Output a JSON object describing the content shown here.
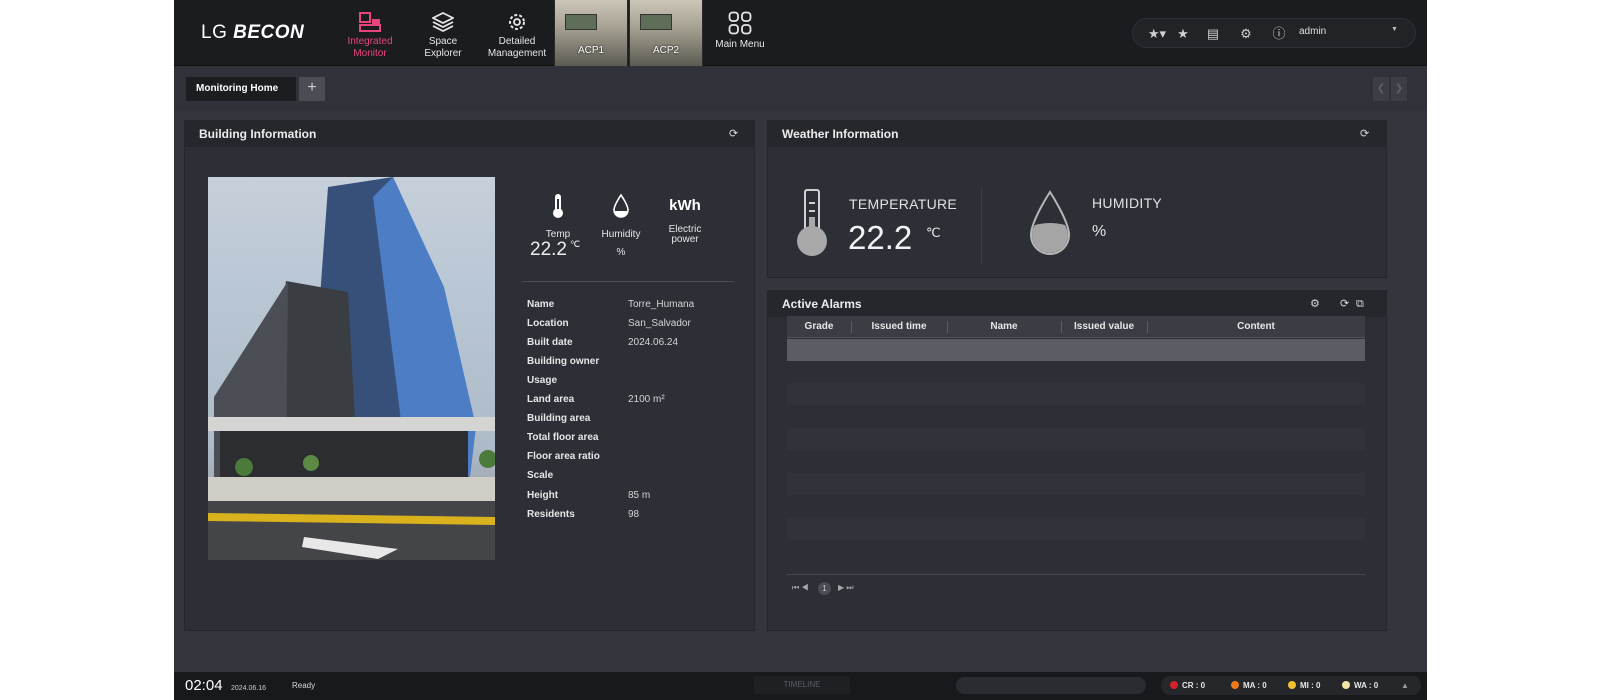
{
  "header": {
    "logo_lg": "LG",
    "logo_becon": "BECON",
    "nav": [
      {
        "label1": "Integrated",
        "label2": "Monitor"
      },
      {
        "label1": "Space",
        "label2": "Explorer"
      },
      {
        "label1": "Detailed",
        "label2": "Management"
      }
    ],
    "acp1": "ACP1",
    "acp2": "ACP2",
    "main_menu": "Main Menu",
    "user": "admin"
  },
  "tabs": {
    "active": "Monitoring Home",
    "add": "+"
  },
  "building_panel": {
    "title": "Building Information",
    "temp_label": "Temp",
    "temp_value": "22.2",
    "temp_unit": "℃",
    "humidity_label": "Humidity",
    "humidity_unit": "%",
    "power_symbol": "kWh",
    "power_label1": "Electric",
    "power_label2": "power",
    "info": [
      {
        "key": "Name",
        "value": "Torre_Humana"
      },
      {
        "key": "Location",
        "value": "San_Salvador"
      },
      {
        "key": "Built date",
        "value": "2024.06.24"
      },
      {
        "key": "Building owner",
        "value": ""
      },
      {
        "key": "Usage",
        "value": ""
      },
      {
        "key": "Land area",
        "value": "2100 m²"
      },
      {
        "key": "Building area",
        "value": ""
      },
      {
        "key": "Total floor area",
        "value": ""
      },
      {
        "key": "Floor area ratio",
        "value": ""
      },
      {
        "key": "Scale",
        "value": ""
      },
      {
        "key": "Height",
        "value": "85 m"
      },
      {
        "key": "Residents",
        "value": "98"
      }
    ]
  },
  "weather_panel": {
    "title": "Weather Information",
    "temp_label": "TEMPERATURE",
    "temp_value": "22.2",
    "temp_unit": "℃",
    "humidity_label": "HUMIDITY",
    "humidity_unit": "%"
  },
  "alarms_panel": {
    "title": "Active Alarms",
    "columns": [
      "Grade",
      "Issued time",
      "Name",
      "Issued value",
      "Content"
    ],
    "current_page": "1"
  },
  "status_bar": {
    "time": "02:04",
    "date": "2024.06.16",
    "status": "Ready",
    "timeline": "TIMELINE",
    "counts": [
      {
        "label": "CR : 0",
        "color": "#d6212b"
      },
      {
        "label": "MA : 0",
        "color": "#f07a1a"
      },
      {
        "label": "MI : 0",
        "color": "#f2c230"
      },
      {
        "label": "WA : 0",
        "color": "#f3e7a5"
      }
    ]
  },
  "colors": {
    "accent": "#e8457d",
    "background": "#33363d",
    "panel": "#2c2f35",
    "topbar": "#1b1c20"
  }
}
